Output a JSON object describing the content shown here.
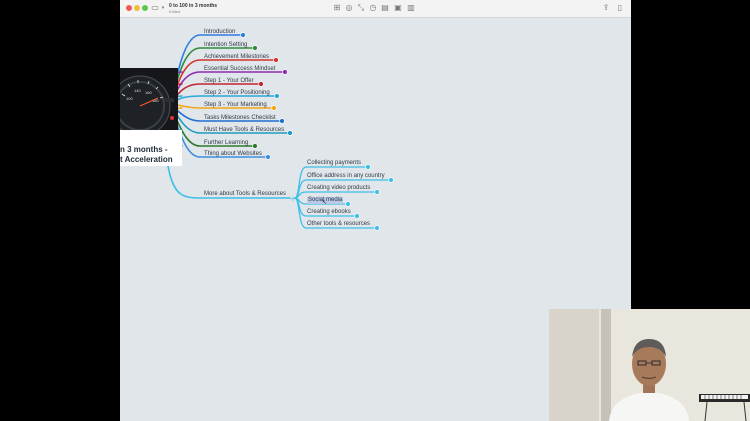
{
  "window": {
    "title": "0 to 100 in 3 months",
    "status": "Edited",
    "background_color": "#e1e6ea"
  },
  "toolbar_icons": [
    "sidebar-icon",
    "chevron-down-icon",
    "grid-icon",
    "check-icon",
    "connect-icon",
    "clock-icon",
    "note-icon",
    "image-icon",
    "share-icon",
    "panel-icon"
  ],
  "central_topic": {
    "line1": "n 3 months -",
    "line2": "t Acceleration"
  },
  "branches": [
    {
      "label": "Introduction",
      "color": "#2f7de1"
    },
    {
      "label": "Intention Setting",
      "color": "#2e8b3a"
    },
    {
      "label": "Achievement Milestones",
      "color": "#d0342c"
    },
    {
      "label": "Essential Success Mindset",
      "color": "#8e2bb0"
    },
    {
      "label": "Step 1 - Your Offer",
      "color": "#c0262d"
    },
    {
      "label": "Step 2 - Your Positioning",
      "color": "#2aa7d8"
    },
    {
      "label": "Step 3 - Your Marketing",
      "color": "#f2a516"
    },
    {
      "label": "Tasks Milestones Checklist",
      "color": "#1f6fd0"
    },
    {
      "label": "Must Have Tools & Resources",
      "color": "#1f9bbf"
    },
    {
      "label": "Further Learning",
      "color": "#2c7a2c"
    },
    {
      "label": "Thing about Websites",
      "color": "#3b8fe0"
    },
    {
      "label": "More about Tools & Resources",
      "color": "#3ec0e6"
    }
  ],
  "sub_branches": [
    {
      "label": "Collecting payments"
    },
    {
      "label": "Office address in any country"
    },
    {
      "label": "Creating video products"
    },
    {
      "label": "Social media"
    },
    {
      "label": "Creating ebooks"
    },
    {
      "label": "Other tools & resources"
    }
  ],
  "selected_sub_branch": "Social media"
}
